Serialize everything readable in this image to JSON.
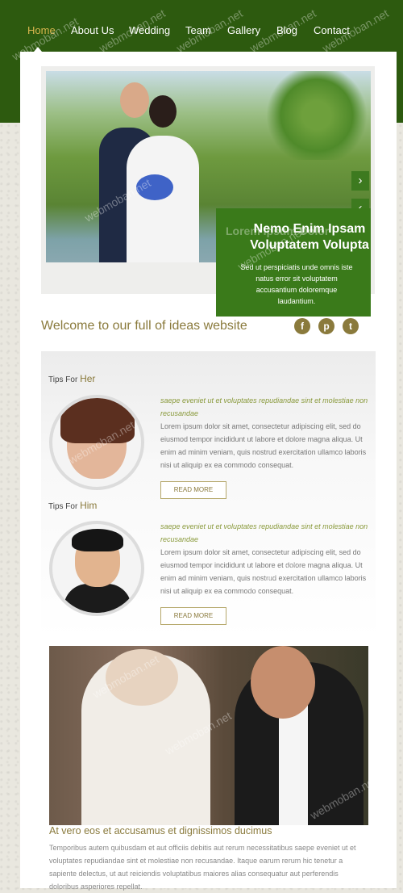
{
  "nav": {
    "items": [
      {
        "label": "Home",
        "active": true
      },
      {
        "label": "About Us",
        "active": false
      },
      {
        "label": "Wedding",
        "active": false
      },
      {
        "label": "Team",
        "active": false
      },
      {
        "label": "Gallery",
        "active": false
      },
      {
        "label": "Blog",
        "active": false
      },
      {
        "label": "Contact",
        "active": false
      }
    ]
  },
  "slider": {
    "next_icon": "chevron-right-icon",
    "prev_icon": "chevron-left-icon",
    "next_glyph": "›",
    "prev_glyph": "‹",
    "caption": {
      "ghost": "Lorem Ipsum Dolor",
      "title_line1": "Nemo Enim Ipsam",
      "title_line2": "Voluptatem Volupta",
      "text": "Sed ut perspiciatis unde omnis iste natus error sit voluptatem accusantium doloremque laudantium."
    }
  },
  "welcome": {
    "text": "Welcome to our full of ideas website",
    "social": [
      {
        "icon": "facebook-icon",
        "glyph": "f"
      },
      {
        "icon": "pinterest-icon",
        "glyph": "p"
      },
      {
        "icon": "twitter-icon",
        "glyph": "t"
      }
    ]
  },
  "tips": [
    {
      "prefix": "Tips For",
      "who": "Her",
      "lead": "saepe eveniet ut et voluptates repudiandae sint et molestiae non recusandae",
      "body": "Lorem ipsum dolor sit amet, consectetur adipiscing elit, sed do eiusmod tempor incididunt ut labore et dolore magna aliqua. Ut enim ad minim veniam, quis nostrud exercitation ullamco laboris nisi ut aliquip ex ea commodo consequat.",
      "button": "READ MORE"
    },
    {
      "prefix": "Tips For",
      "who": "Him",
      "lead": "saepe eveniet ut et voluptates repudiandae sint et molestiae non recusandae",
      "body": "Lorem ipsum dolor sit amet, consectetur adipiscing elit, sed do eiusmod tempor incididunt ut labore et dolore magna aliqua. Ut enim ad minim veniam, quis nostrud exercitation ullamco laboris nisi ut aliquip ex ea commodo consequat.",
      "button": "READ MORE"
    }
  ],
  "article": {
    "title": "At vero eos et accusamus et dignissimos ducimus",
    "text": "Temporibus autem quibusdam et aut officiis debitis aut rerum necessitatibus saepe eveniet ut et voluptates repudiandae sint et molestiae non recusandae. Itaque earum rerum hic tenetur a sapiente delectus, ut aut reiciendis voluptatibus maiores alias consequatur aut perferendis doloribus asperiores repellat."
  },
  "watermark": "webmoban.net",
  "colors": {
    "header_green": "#2d5a0f",
    "caption_green": "#3a7a1a",
    "accent_gold": "#8a7a3c",
    "nav_active": "#d9b64e"
  }
}
